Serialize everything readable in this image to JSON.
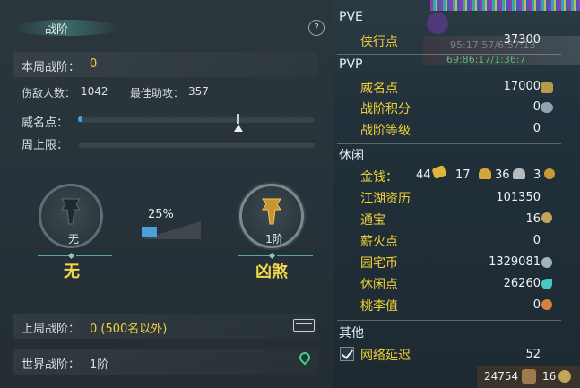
{
  "left": {
    "title": "战阶",
    "help_label": "?",
    "weekly_rank_label": "本周战阶：",
    "weekly_rank_value": "0",
    "kills_label": "伤敌人数：",
    "kills_value": "1042",
    "assist_label": "最佳助攻：",
    "assist_value": "357",
    "prestige_label": "威名点：",
    "weekly_cap_label": "周上限：",
    "current_rank": {
      "sub": "无",
      "name": "无"
    },
    "next_rank": {
      "sub": "1阶",
      "name": "凶煞"
    },
    "progress_pct": "25%",
    "last_week_label": "上周战阶：",
    "last_week_value": "0 (500名以外)",
    "world_rank_label": "世界战阶：",
    "world_rank_value": "1阶"
  },
  "right": {
    "bg_grey_text": "95:17:57/6:57:13",
    "bg_green_text": "69:86:17/1:36:7",
    "pve_header": "PVE",
    "chivalry_label": "侠行点",
    "chivalry_value": "37300",
    "pvp_header": "PVP",
    "prestige_label": "威名点",
    "prestige_value": "17000",
    "battle_score_label": "战阶积分",
    "battle_score_value": "0",
    "battle_level_label": "战阶等级",
    "battle_level_value": "0",
    "leisure_header": "休闲",
    "money_label": "金钱：",
    "money_gold": "44",
    "money_silver_a": "17",
    "money_silver_b": "36",
    "money_copper": "3",
    "jianghu_label": "江湖资历",
    "jianghu_value": "101350",
    "tongbao_label": "通宝",
    "tongbao_value": "16",
    "firewood_label": "薪火点",
    "firewood_value": "0",
    "garden_label": "园宅币",
    "garden_value": "1329081",
    "leisure_pts_label": "休闲点",
    "leisure_pts_value": "26260",
    "peach_label": "桃李值",
    "peach_value": "0",
    "other_header": "其他",
    "latency_label": "网络延迟",
    "latency_value": "52",
    "bottom_value_a": "24754",
    "bottom_value_b": "16"
  }
}
